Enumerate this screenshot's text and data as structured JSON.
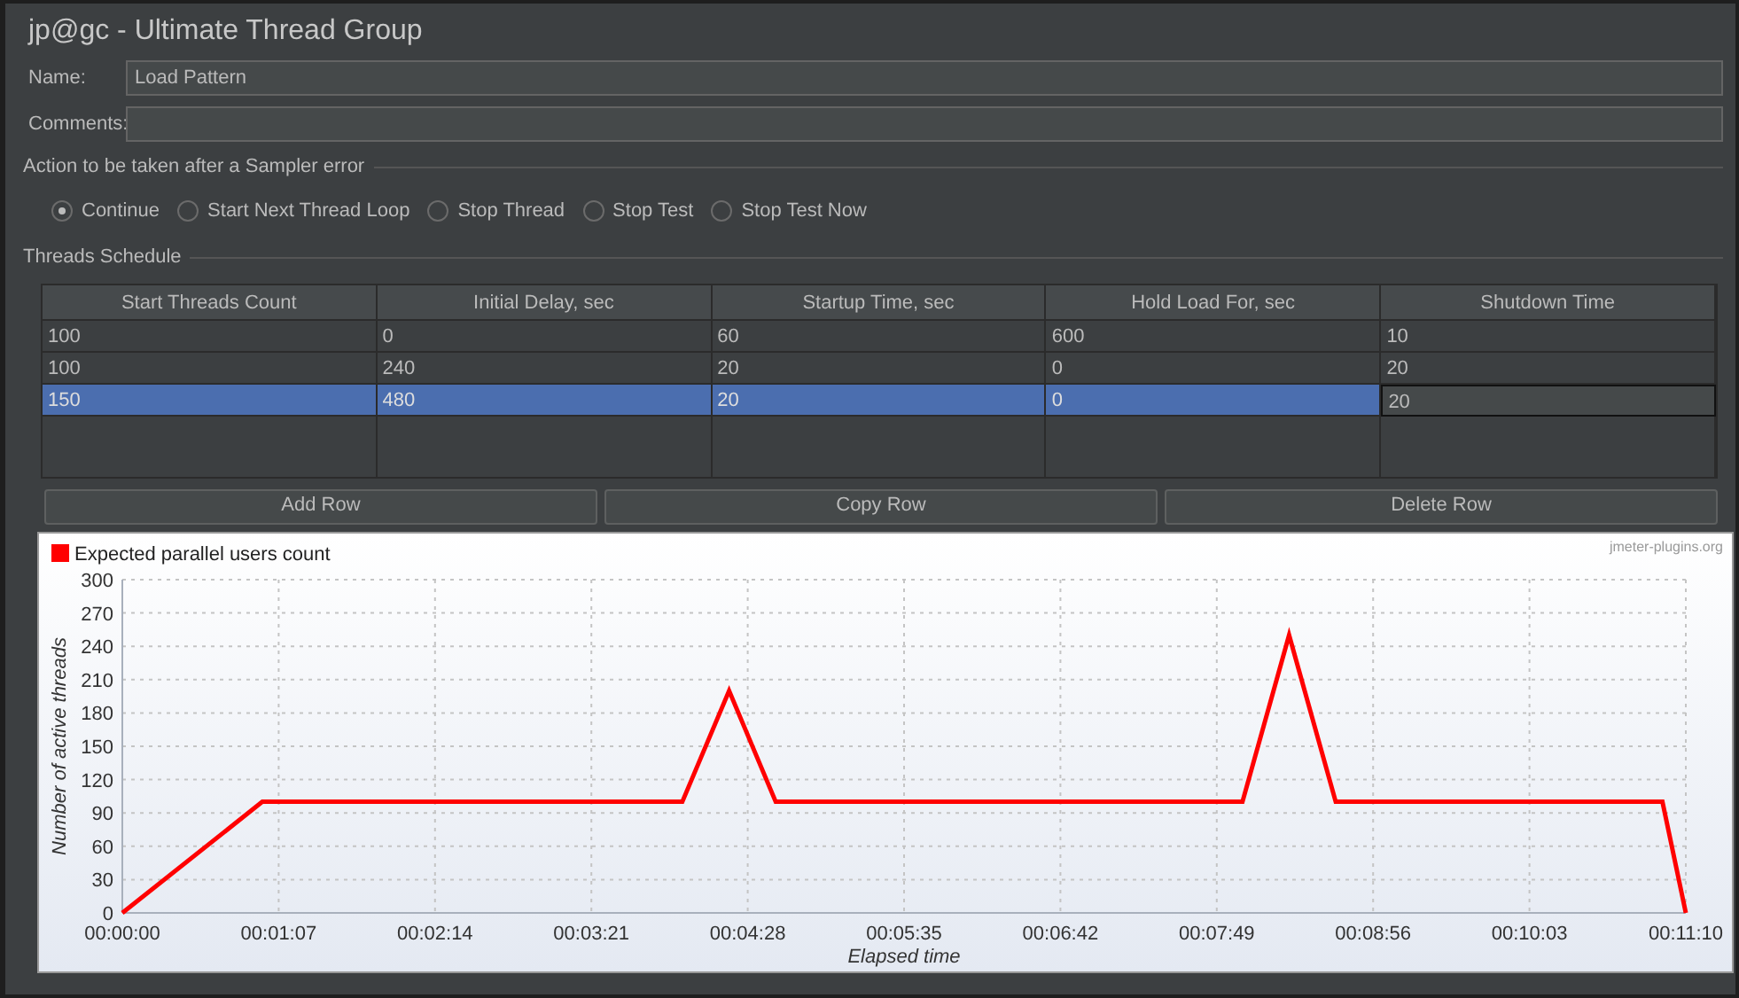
{
  "window": {
    "title": "jp@gc - Ultimate Thread Group"
  },
  "fields": [
    {
      "label": "Name:",
      "value": "Load Pattern"
    },
    {
      "label": "Comments:"
    }
  ],
  "error_action": {
    "title": "Action to be taken after a Sampler error",
    "options": [
      {
        "label": "Continue",
        "selected": true
      },
      {
        "label": "Start Next Thread Loop",
        "selected": false
      },
      {
        "label": "Stop Thread",
        "selected": false
      },
      {
        "label": "Stop Test",
        "selected": false
      },
      {
        "label": "Stop Test Now",
        "selected": false
      }
    ]
  },
  "schedule": {
    "title": "Threads Schedule",
    "columns": [
      "Start Threads Count",
      "Initial Delay, sec",
      "Startup Time, sec",
      "Hold Load For, sec",
      "Shutdown Time"
    ],
    "rows": [
      {
        "cells": [
          "100",
          "0",
          "60",
          "600",
          "10"
        ],
        "selected": false,
        "editing": false
      },
      {
        "cells": [
          "100",
          "240",
          "20",
          "0",
          "20"
        ],
        "selected": false,
        "editing": false
      },
      {
        "cells": [
          "150",
          "480",
          "20",
          "0",
          "20"
        ],
        "selected": true,
        "editing": true
      }
    ]
  },
  "buttons": [
    "Add Row",
    "Copy Row",
    "Delete Row"
  ],
  "chart": {
    "credit": "jmeter-plugins.org",
    "chart_data": {
      "type": "line",
      "grid": true,
      "xlabel": "Elapsed time",
      "ylabel": "Number of active threads",
      "x": [
        0,
        60,
        240,
        260,
        280,
        480,
        500,
        520,
        660,
        670
      ],
      "series": [
        {
          "name": "Expected parallel users count",
          "color": "#ff0000",
          "values": [
            0,
            100,
            100,
            200,
            100,
            100,
            250,
            100,
            100,
            0
          ]
        }
      ],
      "xlim": [
        0,
        670
      ],
      "ylim": [
        0,
        300
      ],
      "xticks": [
        {
          "value": 0,
          "label": "00:00:00"
        },
        {
          "value": 67,
          "label": "00:01:07"
        },
        {
          "value": 134,
          "label": "00:02:14"
        },
        {
          "value": 201,
          "label": "00:03:21"
        },
        {
          "value": 268,
          "label": "00:04:28"
        },
        {
          "value": 335,
          "label": "00:05:35"
        },
        {
          "value": 402,
          "label": "00:06:42"
        },
        {
          "value": 469,
          "label": "00:07:49"
        },
        {
          "value": 536,
          "label": "00:08:56"
        },
        {
          "value": 603,
          "label": "00:10:03"
        },
        {
          "value": 670,
          "label": "00:11:10"
        }
      ],
      "yticks": [
        0,
        30,
        60,
        90,
        120,
        150,
        180,
        210,
        240,
        270,
        300
      ]
    }
  }
}
